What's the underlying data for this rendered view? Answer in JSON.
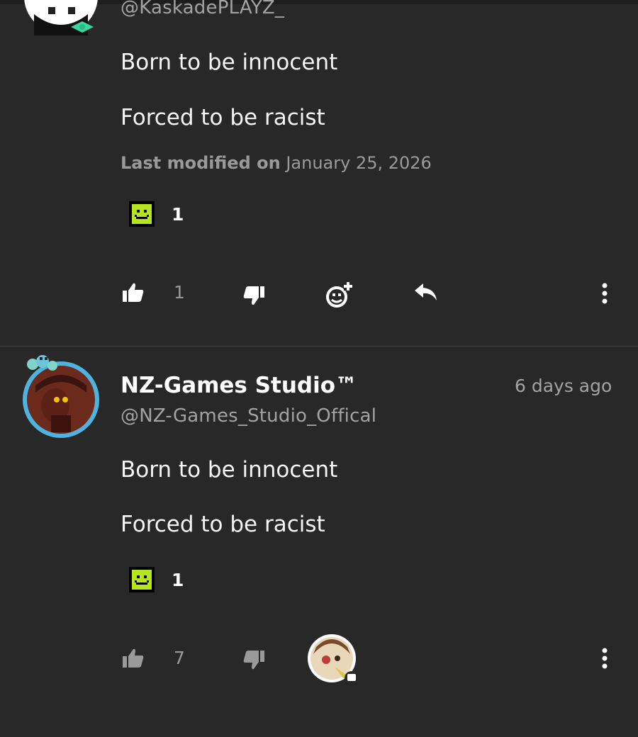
{
  "comments": [
    {
      "handle": "@KaskadePLAYZ_",
      "lines": [
        "Born to be innocent",
        "Forced to be racist"
      ],
      "modified_label": "Last modified on",
      "modified_date": "January 25, 2026",
      "reaction": {
        "icon": "smiley-emoji-icon",
        "count": "1"
      },
      "likes": "1",
      "actions": [
        "thumbs-up-icon",
        "thumbs-down-icon",
        "add-reaction-icon",
        "reply-icon",
        "more-icon"
      ]
    },
    {
      "name": "NZ-Games Studio™",
      "handle": "@NZ-Games_Studio_Offical",
      "time": "6 days ago",
      "lines": [
        "Born to be innocent",
        "Forced to be racist"
      ],
      "reaction": {
        "icon": "smiley-emoji-icon",
        "count": "1"
      },
      "likes": "7",
      "actions": [
        "thumbs-up-icon",
        "thumbs-down-icon",
        "replier-avatar",
        "more-icon"
      ]
    }
  ],
  "colors": {
    "background": "#282828",
    "emoji": "#b5e61d",
    "avatar_ring": "#4fb3e0"
  }
}
